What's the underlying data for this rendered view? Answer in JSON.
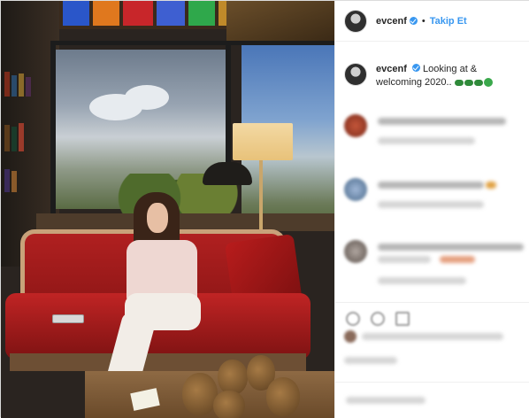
{
  "post": {
    "username": "evcenf",
    "follow_label": "Takip Et",
    "separator": "•",
    "caption_text": "Looking at & welcoming 2020..",
    "emoji_count": 3,
    "accent_color": "#3897f0"
  },
  "photo": {
    "stained_glass_colors": [
      "#c8262a",
      "#2a56c9",
      "#e0781e",
      "#c8262a",
      "#3e5fd1",
      "#2fa84b"
    ]
  }
}
